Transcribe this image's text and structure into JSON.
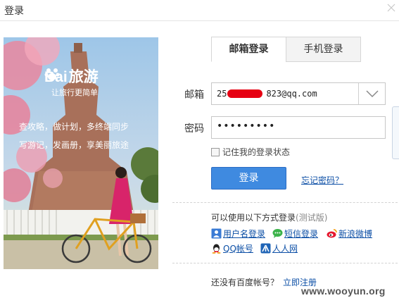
{
  "window": {
    "title": "登录"
  },
  "banner": {
    "brand_left": "Bai",
    "brand_right": "旅游",
    "slogan": "让旅行更简单",
    "promo_line1": "查攻略，做计划，多终端同步",
    "promo_line2": "写游记，发画册，享美丽旅途"
  },
  "tabs": [
    {
      "label": "邮箱登录",
      "active": true
    },
    {
      "label": "手机登录",
      "active": false
    }
  ],
  "form": {
    "email_label": "邮箱",
    "email_prefix": "25",
    "email_value": "823@qq.com",
    "password_label": "密码",
    "password_value": "•••••••••",
    "remember_label": "记住我的登录状态",
    "remember_checked": false,
    "login_button": "登录",
    "forgot_link": "忘记密码？"
  },
  "other_login": {
    "title": "可以使用以下方式登录",
    "beta": "(测试版)",
    "options": [
      {
        "label": "用户名登录",
        "icon": "user-icon"
      },
      {
        "label": "短信登录",
        "icon": "sms-icon"
      },
      {
        "label": "新浪微博",
        "icon": "weibo-icon"
      },
      {
        "label": "QQ帐号",
        "icon": "qq-icon"
      },
      {
        "label": "人人网",
        "icon": "renren-icon"
      }
    ]
  },
  "register": {
    "prompt": "还没有百度帐号？",
    "link": "立即注册"
  },
  "watermark": "www.wooyun.org",
  "colors": {
    "button_blue": "#3f8ae0",
    "link_blue": "#0c4fa6",
    "redaction_red": "#e60012"
  }
}
